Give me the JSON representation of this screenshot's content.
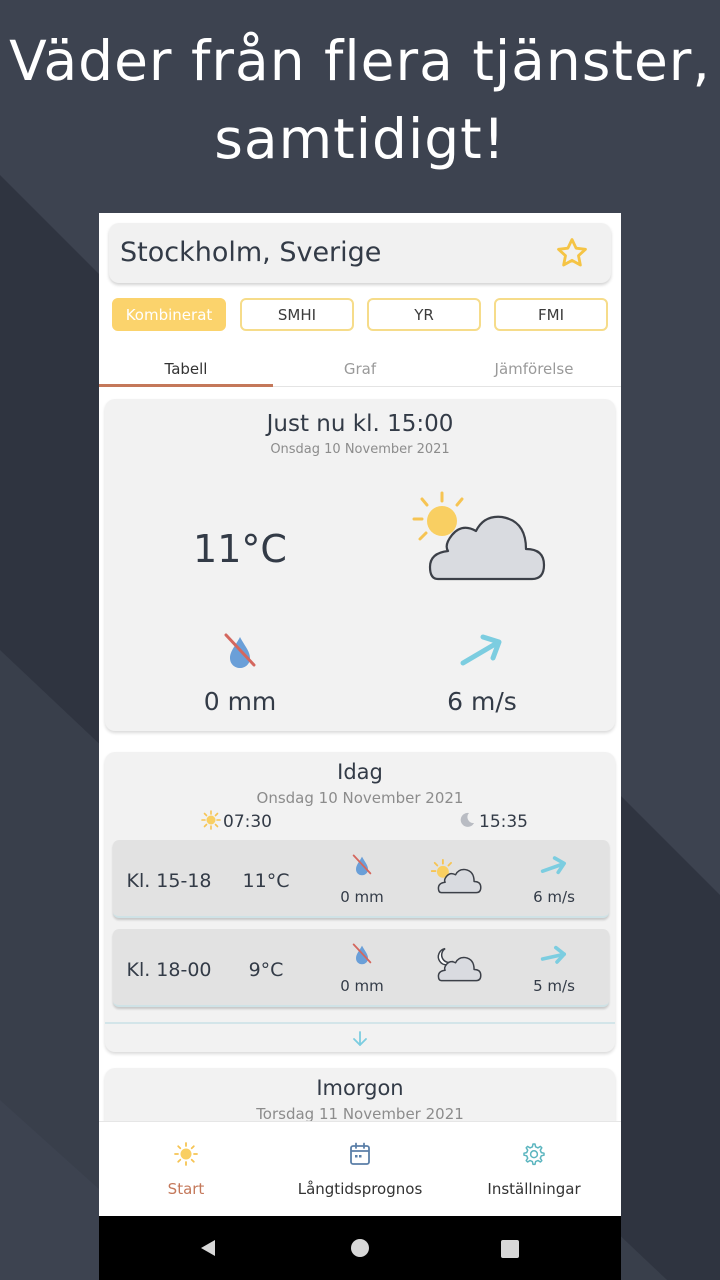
{
  "headline": {
    "line1": "Väder från flera tjänster,",
    "line2": "samtidigt!"
  },
  "location": {
    "name": "Stockholm, Sverige"
  },
  "sources": [
    "Kombinerat",
    "SMHI",
    "YR",
    "FMI"
  ],
  "tabs": [
    "Tabell",
    "Graf",
    "Jämförelse"
  ],
  "now": {
    "title": "Just nu kl. 15:00",
    "date": "Onsdag 10 November 2021",
    "temp": "11°C",
    "precip": "0 mm",
    "wind": "6 m/s"
  },
  "today": {
    "title": "Idag",
    "date": "Onsdag 10 November 2021",
    "sunrise": "07:30",
    "sunset": "15:35",
    "rows": [
      {
        "time": "Kl. 15-18",
        "temp": "11°C",
        "precip": "0 mm",
        "wind": "6 m/s"
      },
      {
        "time": "Kl. 18-00",
        "temp": "9°C",
        "precip": "0 mm",
        "wind": "5 m/s"
      }
    ]
  },
  "tomorrow": {
    "title": "Imorgon",
    "date": "Torsdag 11 November 2021"
  },
  "nav": [
    "Start",
    "Långtidsprognos",
    "Inställningar"
  ],
  "colors": {
    "accent": "#fbd36c",
    "active_nav": "#c4785a",
    "wind": "#7ccde0",
    "drop": "#6a9fd8"
  }
}
